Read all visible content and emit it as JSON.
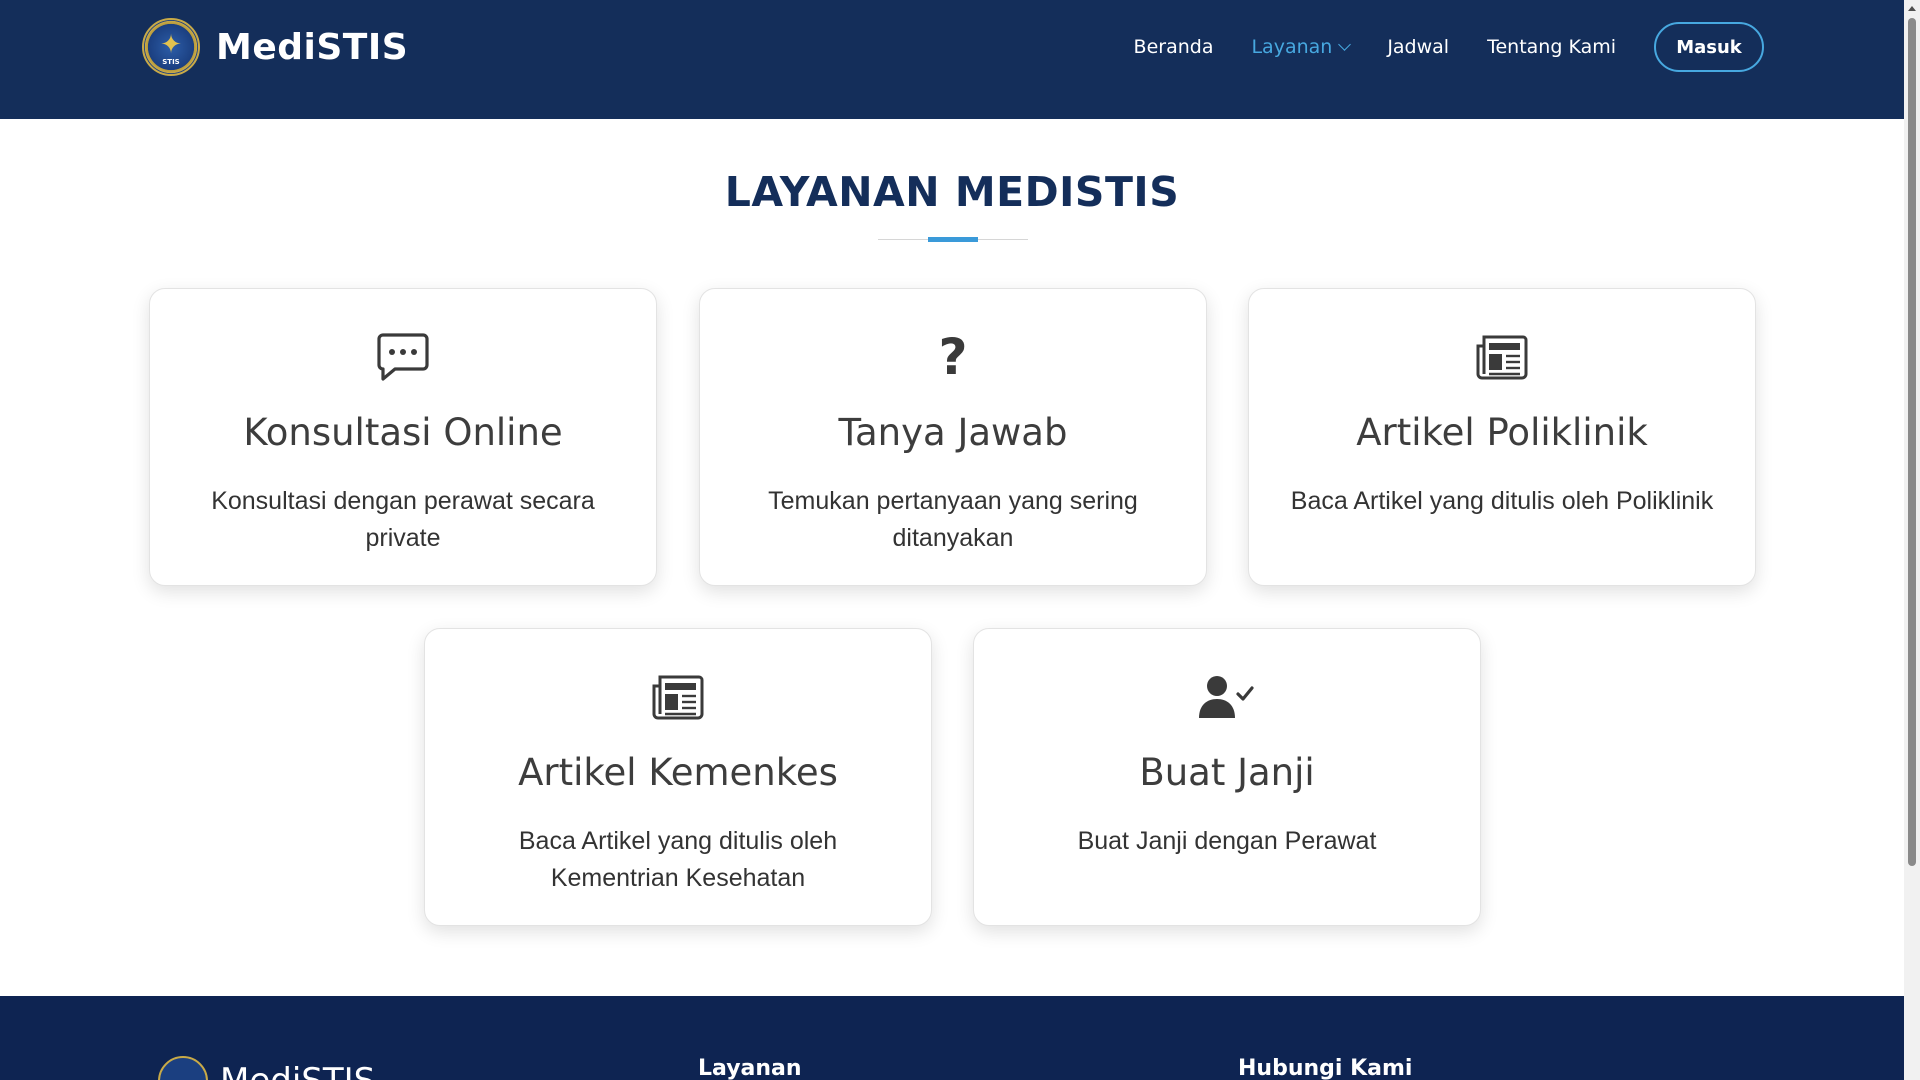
{
  "header": {
    "brand": "MediSTIS",
    "logo_text": "STIS",
    "nav": {
      "home": "Beranda",
      "services": "Layanan",
      "schedule": "Jadwal",
      "about": "Tentang Kami",
      "login": "Masuk"
    }
  },
  "section": {
    "title": "LAYANAN MEDISTIS"
  },
  "cards": [
    {
      "icon": "chat-dots-icon",
      "title": "Konsultasi Online",
      "desc": "Konsultasi dengan perawat secara private"
    },
    {
      "icon": "question-icon",
      "title": "Tanya Jawab",
      "desc": "Temukan pertanyaan yang sering ditanyakan"
    },
    {
      "icon": "newspaper-icon",
      "title": "Artikel Poliklinik",
      "desc": "Baca Artikel yang ditulis oleh Poliklinik"
    },
    {
      "icon": "newspaper-icon",
      "title": "Artikel Kemenkes",
      "desc": "Baca Artikel yang ditulis oleh Kementrian Kesehatan"
    },
    {
      "icon": "user-check-icon",
      "title": "Buat Janji",
      "desc": "Buat Janji dengan Perawat"
    }
  ],
  "footer": {
    "brand": "MediSTIS",
    "col_services": "Layanan",
    "col_contact": "Hubungi Kami"
  },
  "colors": {
    "header_bg": "#142e5a",
    "accent": "#47a8e0",
    "footer_bg": "#0e2452"
  }
}
